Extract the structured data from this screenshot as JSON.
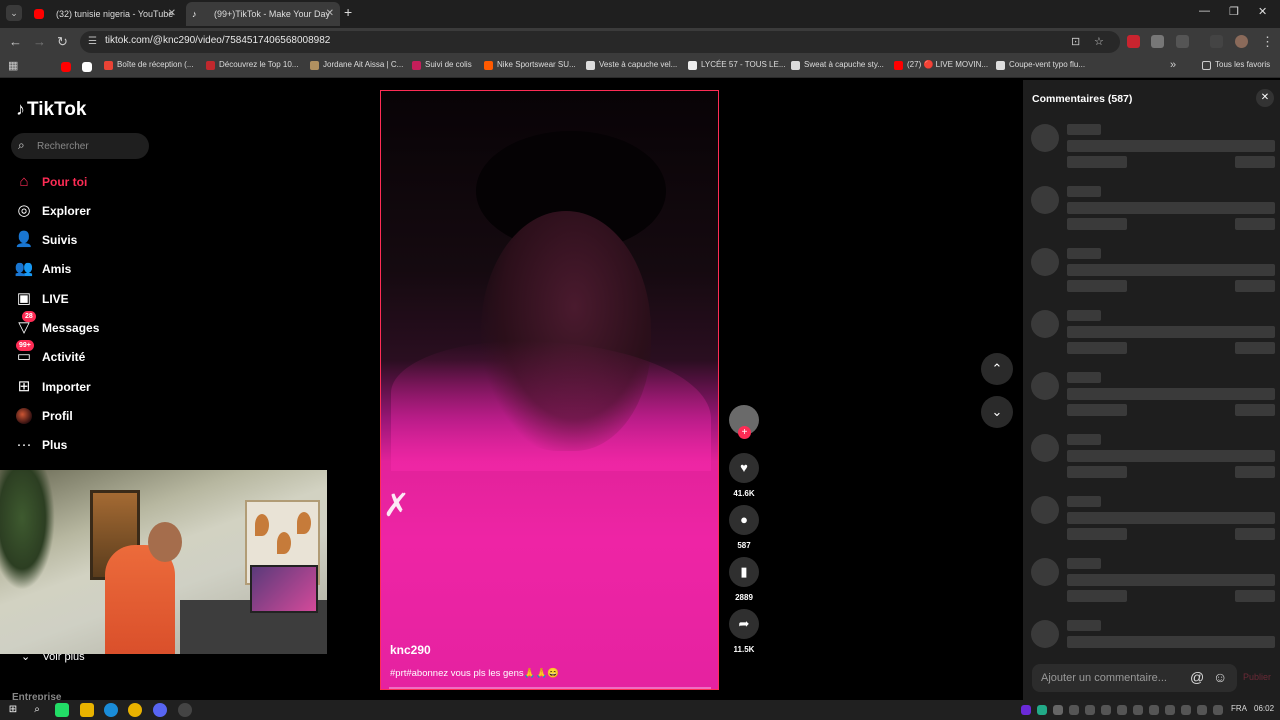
{
  "browser": {
    "tabs": [
      {
        "label": "(32) tunisie nigeria - YouTube",
        "favicon_color": "#ff0000"
      },
      {
        "label": "(99+)TikTok - Make Your Day",
        "favicon_color": "#ffffff"
      }
    ],
    "url": "tiktok.com/@knc290/video/7584517406568008982",
    "bookmarks": [
      "Boîte de réception (...",
      "Découvrez le Top 10...",
      "Jordane Ait Aissa | C...",
      "Suivi de colis",
      "Nike Sportswear SU...",
      "Veste à capuche vel...",
      "LYCÉE 57 - TOUS LE...",
      "Sweat à capuche sty...",
      "(27) 🔴 LIVE MOVIN...",
      "Coupe-vent typo flu..."
    ],
    "all_bookmarks_label": "Tous les favoris"
  },
  "tiktok": {
    "logo": "TikTok",
    "search_placeholder": "Rechercher",
    "nav": [
      {
        "label": "Pour toi",
        "icon": "home-icon",
        "active": true
      },
      {
        "label": "Explorer",
        "icon": "compass-icon"
      },
      {
        "label": "Suivis",
        "icon": "following-icon"
      },
      {
        "label": "Amis",
        "icon": "friends-icon"
      },
      {
        "label": "LIVE",
        "icon": "live-icon"
      },
      {
        "label": "Messages",
        "icon": "messages-icon",
        "badge": "28"
      },
      {
        "label": "Activité",
        "icon": "activity-icon",
        "badge": "99+"
      },
      {
        "label": "Importer",
        "icon": "upload-icon"
      },
      {
        "label": "Profil",
        "icon": "profile-icon"
      },
      {
        "label": "Plus",
        "icon": "more-icon"
      }
    ],
    "see_more": "Voir plus",
    "footer_section": "Entreprise"
  },
  "video": {
    "author": "knc290",
    "caption": "#prt#abonnez vous pls les gens🙏🙏😄",
    "likes": "41.6K",
    "comments": "587",
    "saves": "2889",
    "shares": "11.5K"
  },
  "comments_panel": {
    "title": "Commentaires (587)",
    "input_placeholder": "Ajouter un commentaire...",
    "publish_label": "Publier"
  },
  "taskbar": {
    "language": "FRA",
    "time": "06:02"
  },
  "colors": {
    "accent": "#fe2c55",
    "panel": "#1e1e1e"
  }
}
